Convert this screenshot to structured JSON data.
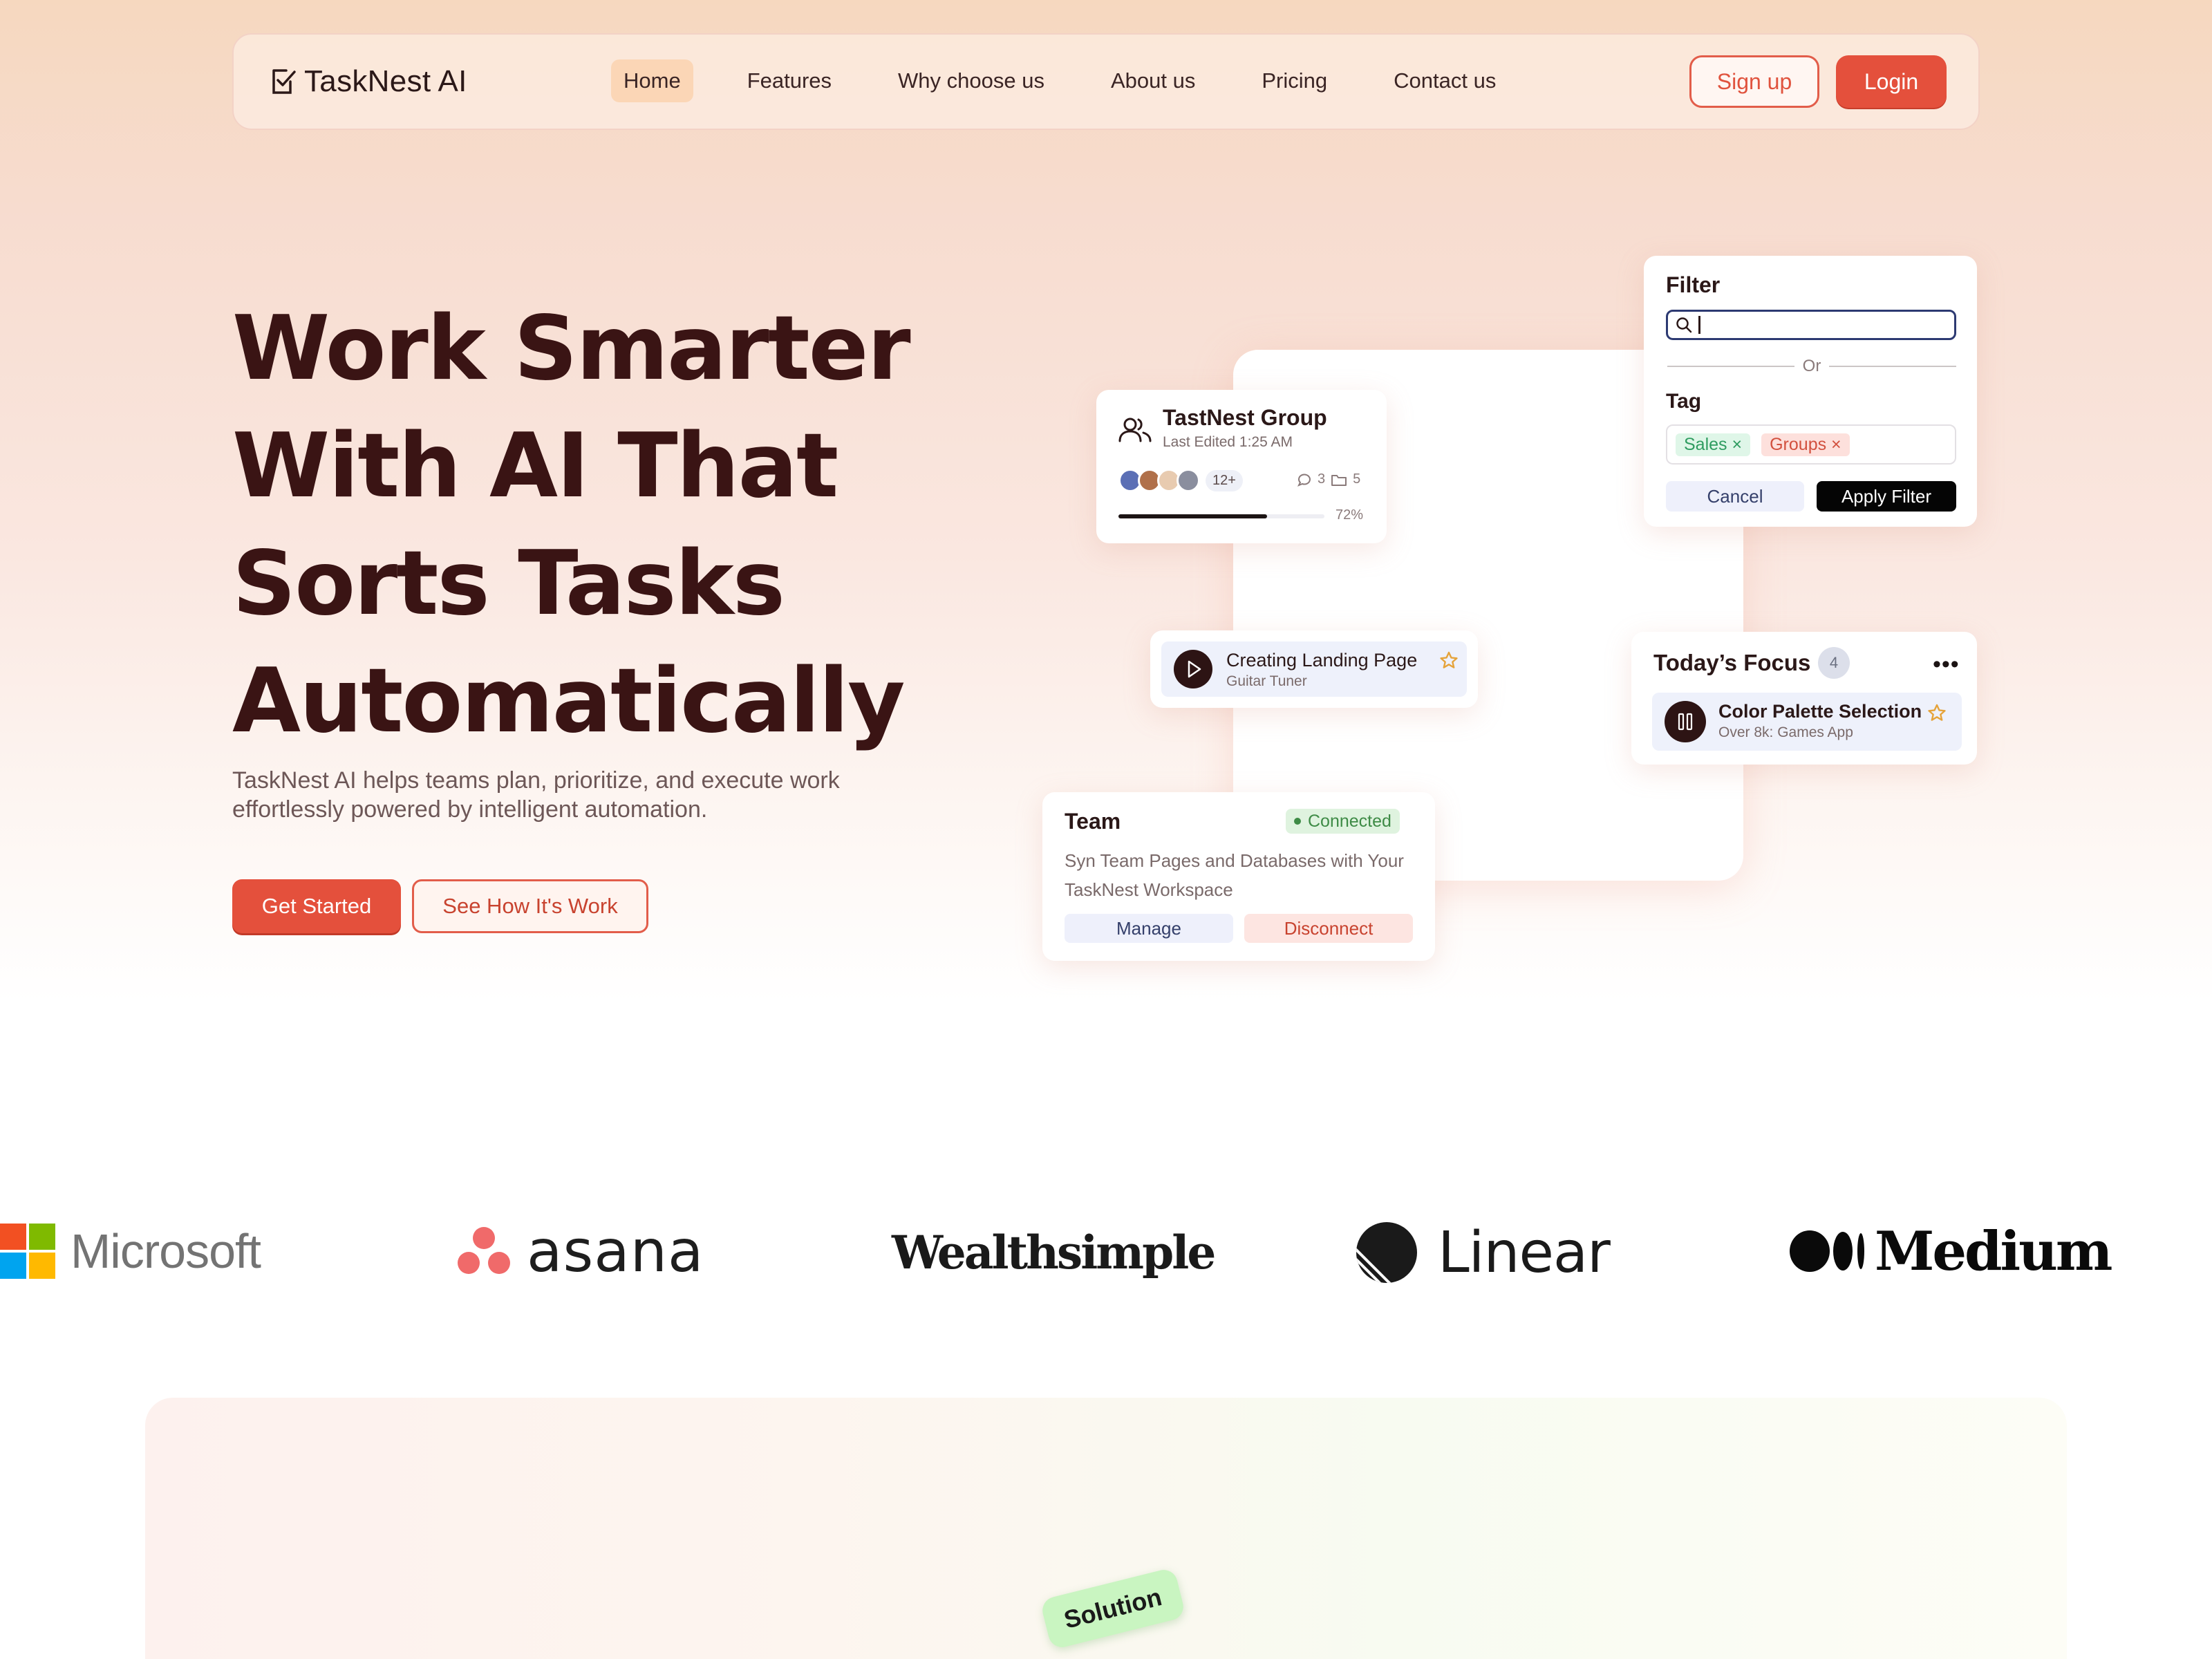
{
  "brand": {
    "name": "TaskNest AI"
  },
  "nav": {
    "items": [
      {
        "label": "Home",
        "active": true
      },
      {
        "label": "Features",
        "active": false
      },
      {
        "label": "Why choose us",
        "active": false
      },
      {
        "label": "About us",
        "active": false
      },
      {
        "label": "Pricing",
        "active": false
      },
      {
        "label": "Contact us",
        "active": false
      }
    ],
    "signup": "Sign up",
    "login": "Login"
  },
  "hero": {
    "title_lines": [
      "Work Smarter",
      "With AI That",
      "Sorts Tasks",
      "Automatically"
    ],
    "subtitle": "TaskNest AI helps teams plan, prioritize, and execute work effortlessly powered by intelligent automation.",
    "cta_primary": "Get Started",
    "cta_secondary": "See How It's Work"
  },
  "group_card": {
    "title": "TastNest Group",
    "subtitle": "Last Edited 1:25 AM",
    "more_count": "12+",
    "comments": "3",
    "folders": "5",
    "progress_label": "72%",
    "progress_value": 0.72
  },
  "filter_card": {
    "title": "Filter",
    "search_value": "",
    "or_label": "Or",
    "tag_label": "Tag",
    "tags": [
      {
        "label": "Sales",
        "color": "green"
      },
      {
        "label": "Groups",
        "color": "red"
      }
    ],
    "cancel": "Cancel",
    "apply": "Apply Filter"
  },
  "task_card": {
    "title": "Creating Landing Page",
    "subtitle": "Guitar Tuner"
  },
  "focus_card": {
    "title": "Today’s Focus",
    "count": "4",
    "more": "•••",
    "item_title": "Color Palette Selection",
    "item_subtitle": "Over 8k: Games App"
  },
  "team_card": {
    "title": "Team",
    "status": "Connected",
    "description": "Syn Team Pages and Databases with Your TaskNest Workspace",
    "manage": "Manage",
    "disconnect": "Disconnect"
  },
  "logos": [
    {
      "name": "Microsoft"
    },
    {
      "name": "asana"
    },
    {
      "name": "Wealthsimple"
    },
    {
      "name": "Linear"
    },
    {
      "name": "Medium"
    }
  ],
  "section2": {
    "badge": "Solution"
  },
  "colors": {
    "primary": "#e4503c",
    "heading": "#3a1414",
    "accent_tag_green": "#2f9c60",
    "accent_tag_red": "#d2503e"
  }
}
